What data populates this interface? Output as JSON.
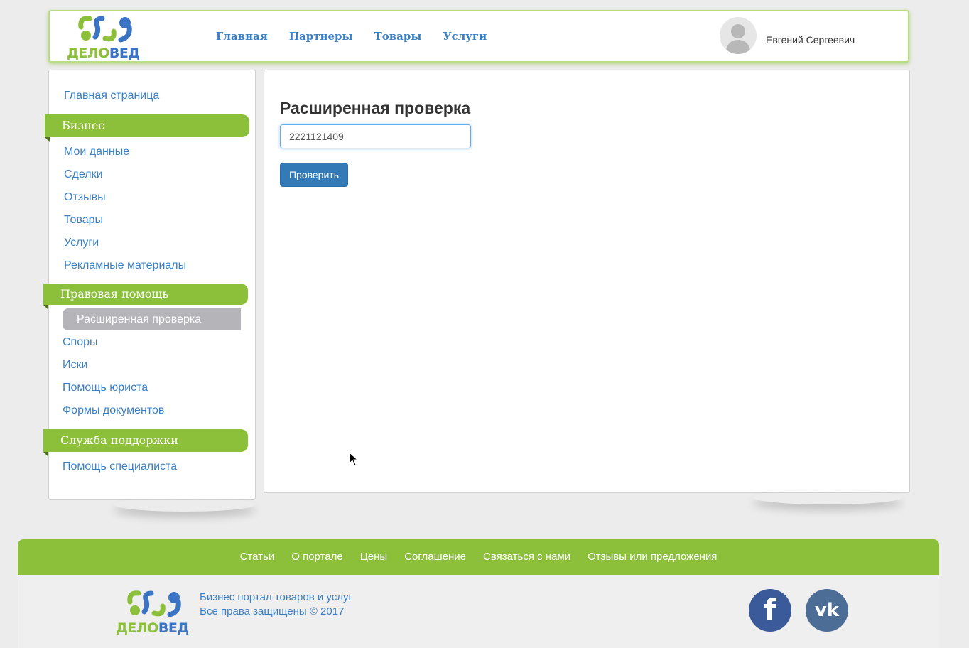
{
  "header": {
    "logo_text_left": "ДЕЛО",
    "logo_text_right": "ВЕД",
    "nav": [
      "Главная",
      "Партнеры",
      "Товары",
      "Услуги"
    ],
    "user_name": "Евгений Сергеевич"
  },
  "sidebar": {
    "home": "Главная страница",
    "sections": [
      {
        "title": "Бизнес",
        "items": [
          "Мои данные",
          "Сделки",
          "Отзывы",
          "Товары",
          "Услуги",
          "Рекламные материалы"
        ]
      },
      {
        "title": "Правовая помощь",
        "active_item": "Расширенная проверка",
        "items": [
          "Споры",
          "Иски",
          "Помощь юриста",
          "Формы документов"
        ]
      },
      {
        "title": "Служба поддержки",
        "items": [
          "Помощь специалиста"
        ]
      }
    ]
  },
  "main": {
    "title": "Расширенная проверка",
    "input_value": "2221121409",
    "button_label": "Проверить"
  },
  "footer": {
    "links": [
      "Статьи",
      "О портале",
      "Цены",
      "Соглашение",
      "Связаться с нами",
      "Отзывы или предложения"
    ],
    "line1": "Бизнес портал товаров и услуг",
    "line2": "Все права защищены © 2017",
    "social": [
      "f",
      "vk"
    ]
  },
  "colors": {
    "brand_green": "#8dc03a",
    "brand_blue": "#3b7fc4",
    "button_blue": "#337ab7"
  }
}
